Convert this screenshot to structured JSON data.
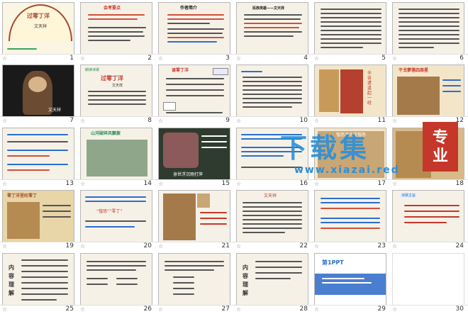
{
  "app": {
    "title": ""
  },
  "slides": [
    {
      "num": "1",
      "texts": [
        "过零丁洋",
        "文天祥"
      ]
    },
    {
      "num": "2",
      "texts": [
        "会考要点"
      ]
    },
    {
      "num": "3",
      "texts": [
        "作者简介"
      ]
    },
    {
      "num": "4",
      "texts": [
        "民族英雄——文天祥"
      ]
    },
    {
      "num": "5",
      "texts": []
    },
    {
      "num": "6",
      "texts": []
    },
    {
      "num": "7",
      "texts": [
        "文天祥"
      ]
    },
    {
      "num": "8",
      "texts": [
        "朗读诗歌",
        "过零丁洋",
        "文天祥"
      ]
    },
    {
      "num": "9",
      "texts": [
        "读零丁洋"
      ]
    },
    {
      "num": "10",
      "texts": []
    },
    {
      "num": "11",
      "texts": [
        "辛苦遭逢起一经"
      ]
    },
    {
      "num": "12",
      "texts": [
        "干戈寥落四周星"
      ]
    },
    {
      "num": "13",
      "texts": []
    },
    {
      "num": "14",
      "texts": [
        "山河破碎风飘絮"
      ]
    },
    {
      "num": "15",
      "texts": [
        "身世浮沉雨打萍"
      ]
    },
    {
      "num": "16",
      "texts": []
    },
    {
      "num": "17",
      "texts": [
        "惶恐滩头说惶恐"
      ]
    },
    {
      "num": "18",
      "texts": [
        "专业"
      ]
    },
    {
      "num": "19",
      "texts": [
        "零丁洋里叹零丁"
      ]
    },
    {
      "num": "20",
      "texts": [
        "“惶恐”“零丁”"
      ]
    },
    {
      "num": "21",
      "texts": []
    },
    {
      "num": "22",
      "texts": [
        "文天祥"
      ]
    },
    {
      "num": "23",
      "texts": []
    },
    {
      "num": "24",
      "texts": [
        "诗歌主旨"
      ]
    },
    {
      "num": "25",
      "texts": [
        "内容理解"
      ]
    },
    {
      "num": "26",
      "texts": []
    },
    {
      "num": "27",
      "texts": []
    },
    {
      "num": "28",
      "texts": [
        "内容理解"
      ]
    },
    {
      "num": "29",
      "texts": [
        "第1PPT"
      ]
    },
    {
      "num": "30",
      "texts": []
    }
  ],
  "watermark": {
    "main": "下载集",
    "url": "www.xiazai.red",
    "badge_line1": "专",
    "badge_line2": "业"
  },
  "colors": {
    "accent_red": "#c6372b",
    "accent_blue": "#2a8fd9",
    "parchment": "#f6f1e7"
  }
}
